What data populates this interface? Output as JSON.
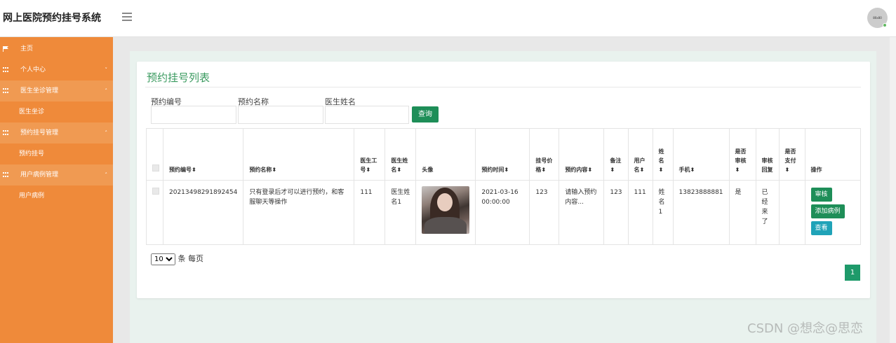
{
  "app": {
    "title": "网上医院预约挂号系统",
    "avatar_text": "80x80"
  },
  "sidebar": {
    "items": [
      {
        "label": "主页",
        "icon": "flag-icon"
      },
      {
        "label": "个人中心",
        "icon": "grid-icon",
        "arrow": "˅"
      },
      {
        "label": "医生坐诊管理",
        "icon": "grid-icon",
        "arrow": "˄"
      },
      {
        "label": "医生坐诊"
      },
      {
        "label": "预约挂号管理",
        "icon": "grid-icon",
        "arrow": "˄"
      },
      {
        "label": "预约挂号"
      },
      {
        "label": "用户病例管理",
        "icon": "grid-icon",
        "arrow": "˄"
      },
      {
        "label": "用户病例"
      }
    ]
  },
  "page": {
    "title": "预约挂号列表",
    "filters": [
      {
        "label": "预约编号",
        "value": ""
      },
      {
        "label": "预约名称",
        "value": ""
      },
      {
        "label": "医生姓名",
        "value": ""
      }
    ],
    "search_label": "查询"
  },
  "table": {
    "headers": [
      "预约编号⬍",
      "预约名称⬍",
      "医生工号⬍",
      "医生姓名⬍",
      "头像",
      "预约时间⬍",
      "挂号价格⬍",
      "预约内容⬍",
      "备注⬍",
      "用户名⬍",
      "姓名⬍",
      "手机⬍",
      "是否审核⬍",
      "审核回复",
      "是否支付⬍",
      "操作"
    ],
    "rows": [
      {
        "id": "20213498291892454",
        "name": "只有登录后才可以进行预约，和客服聊天等操作",
        "doc_no": "111",
        "doc_name": "医生姓名1",
        "time": "2021-03-16 00:00:00",
        "price": "123",
        "content": "请输入预约内容...",
        "remark": "123",
        "username": "111",
        "realname": "姓名1",
        "phone": "13823888881",
        "audited": "是",
        "reply": "已经来了",
        "paid": "",
        "actions": [
          "审核",
          "添加病例",
          "查看"
        ]
      }
    ]
  },
  "pagination": {
    "page_size": "10",
    "per_page_text": "条 每页",
    "current": "1"
  },
  "watermark": "CSDN @想念@思恋",
  "colors": {
    "sidebar": "#ef8a3a",
    "primary": "#1e8e58",
    "info": "#20a3b8",
    "title": "#3a9a5f"
  }
}
